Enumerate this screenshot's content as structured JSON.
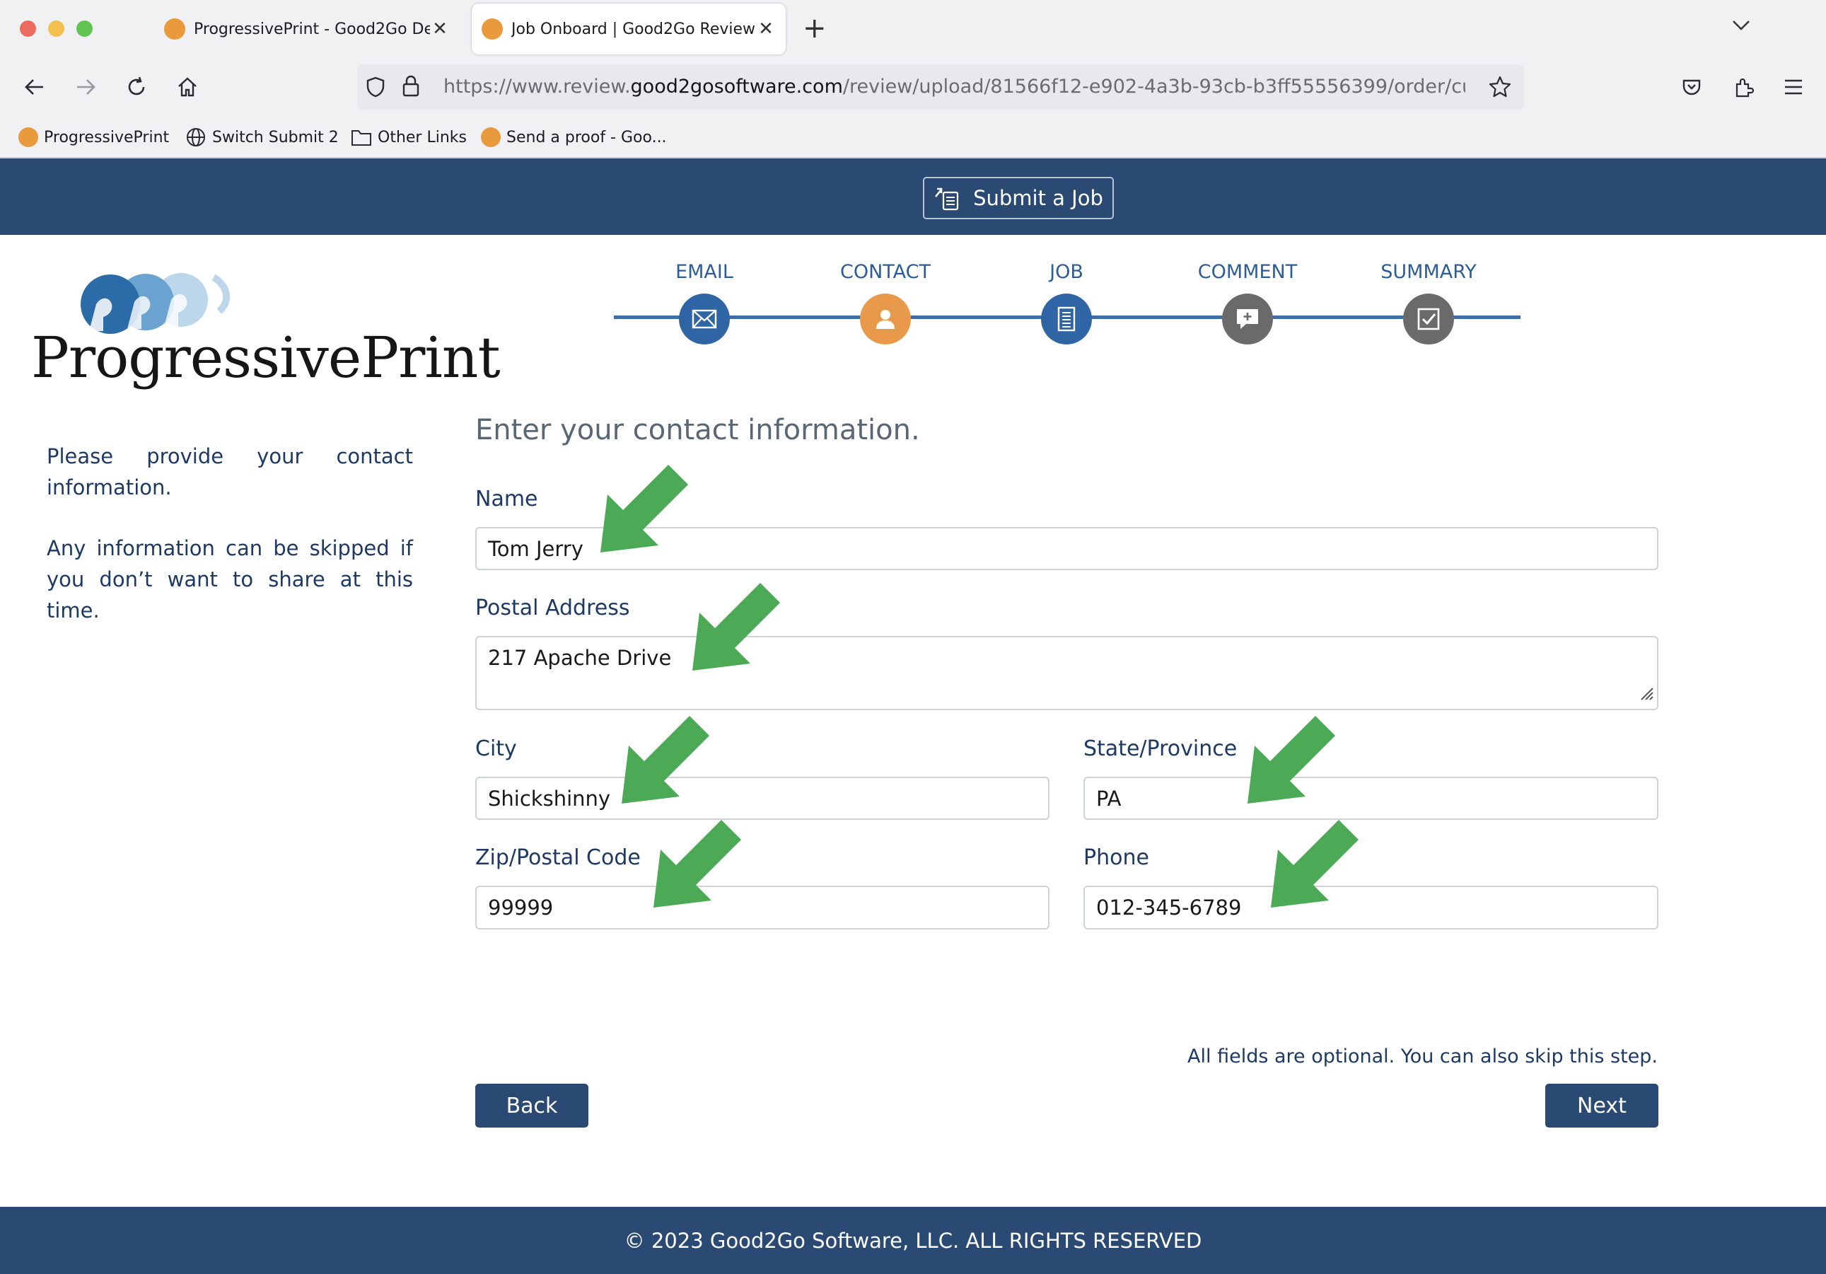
{
  "browser": {
    "tabs": [
      {
        "title": "ProgressivePrint - Good2Go Del",
        "active": false
      },
      {
        "title": "Job Onboard | Good2Go Review",
        "active": true
      }
    ],
    "url_prefix": "https://www.review.",
    "url_domain": "good2gosoftware.com",
    "url_path": "/review/upload/81566f12-e902-4a3b-93cb-b3ff55556399/order/custom",
    "bookmarks": [
      {
        "label": "ProgressivePrint",
        "icon": "good2go-favicon"
      },
      {
        "label": "Switch Submit 2",
        "icon": "globe-icon"
      },
      {
        "label": "Other Links",
        "icon": "folder-icon"
      },
      {
        "label": "Send a proof - Goo...",
        "icon": "good2go-favicon"
      }
    ]
  },
  "header": {
    "submit_label": "Submit a Job"
  },
  "logo": {
    "text": "ProgressivePrint"
  },
  "sidebar": {
    "para1": "Please provide your contact information.",
    "para2": "Any information can be skipped if you don’t want to share at this time."
  },
  "steps": [
    {
      "label": "EMAIL",
      "icon": "envelope-icon",
      "state": "done"
    },
    {
      "label": "CONTACT",
      "icon": "person-icon",
      "state": "current"
    },
    {
      "label": "JOB",
      "icon": "document-icon",
      "state": "done"
    },
    {
      "label": "COMMENT",
      "icon": "comment-icon",
      "state": "todo"
    },
    {
      "label": "SUMMARY",
      "icon": "checkbox-icon",
      "state": "todo"
    }
  ],
  "form": {
    "title": "Enter your contact information.",
    "name_label": "Name",
    "name_value": "Tom Jerry",
    "address_label": "Postal Address",
    "address_value": "217 Apache Drive",
    "city_label": "City",
    "city_value": "Shickshinny",
    "state_label": "State/Province",
    "state_value": "PA",
    "zip_label": "Zip/Postal Code",
    "zip_value": "99999",
    "phone_label": "Phone",
    "phone_value": "012-345-6789",
    "hint": "All fields are optional. You can also skip this step.",
    "back_label": "Back",
    "next_label": "Next"
  },
  "footer": {
    "text": "© 2023 Good2Go Software, LLC. ALL RIGHTS RESERVED"
  },
  "colors": {
    "brand_navy": "#2b4a73",
    "step_blue": "#2f64a5",
    "step_orange": "#e89a4a",
    "step_gray": "#6a6a6a",
    "annotation_green": "#4caa57"
  }
}
